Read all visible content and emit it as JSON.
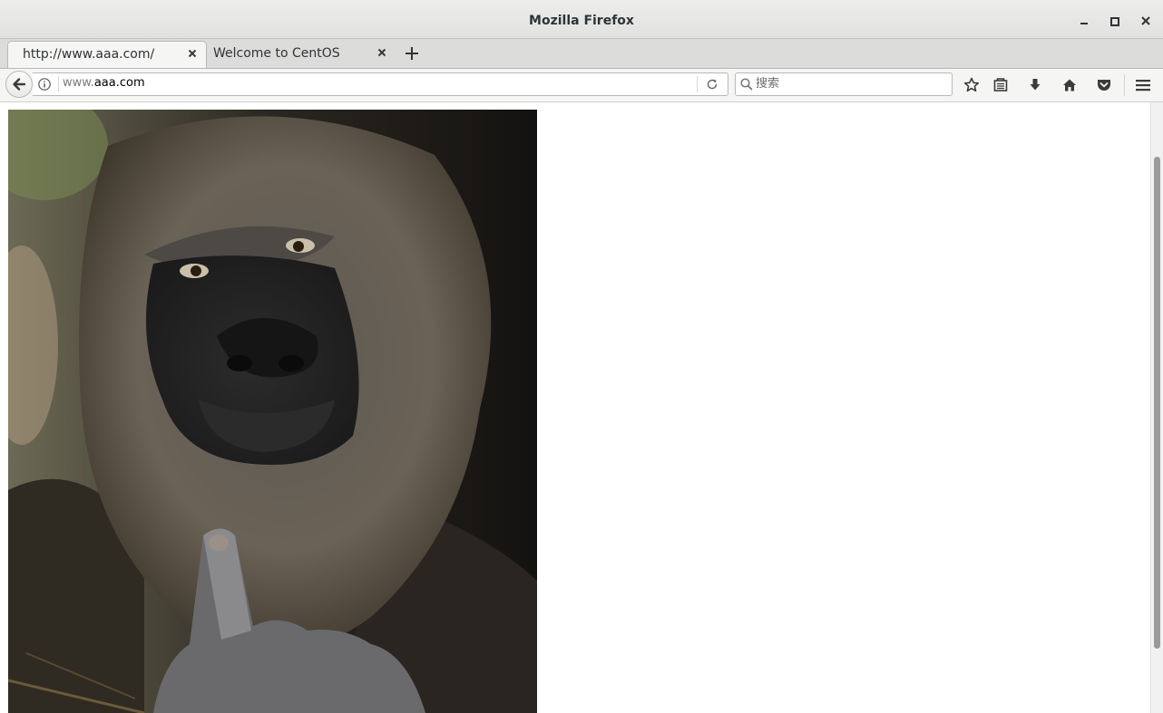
{
  "window": {
    "title": "Mozilla Firefox"
  },
  "tabs": [
    {
      "label": "http://www.aaa.com/",
      "active": true
    },
    {
      "label": "Welcome to CentOS",
      "active": false
    }
  ],
  "navbar": {
    "url_prefix": "www.",
    "url_host": "aaa.com",
    "search_placeholder": "搜索"
  },
  "toolbar_icons": [
    "back-icon",
    "info-icon",
    "reload-icon",
    "search-icon",
    "star-icon",
    "library-icon",
    "download-icon",
    "home-icon",
    "pocket-icon",
    "hamburger-menu-icon"
  ],
  "colors": {
    "titlebar": "#e8e8e7",
    "content_bg": "#ffffff",
    "scroll_thumb": "#9a9a9a"
  },
  "content": {
    "image_subject": "gorilla-photo"
  }
}
